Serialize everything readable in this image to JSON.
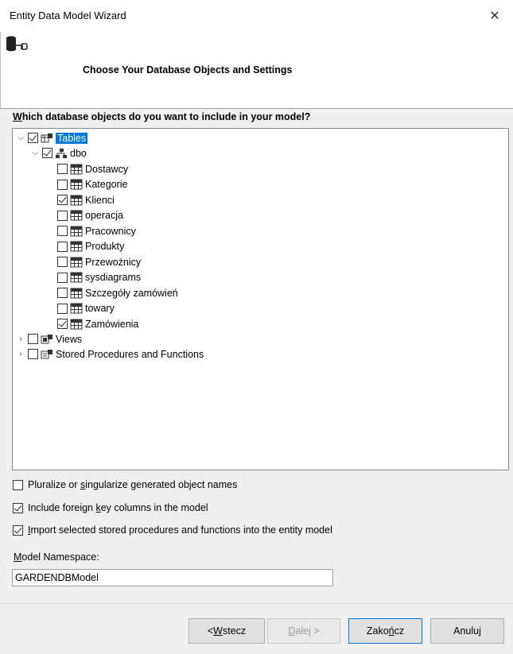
{
  "window": {
    "title": "Entity Data Model Wizard"
  },
  "header": {
    "heading": "Choose Your Database Objects and Settings"
  },
  "question": {
    "ul": "W",
    "rest": "hich database objects do you want to include in your model?"
  },
  "tree": {
    "tables_label": "Tables",
    "schema_label": "dbo",
    "tables": [
      {
        "name": "Dostawcy",
        "checked": false
      },
      {
        "name": "Kategorie",
        "checked": false
      },
      {
        "name": "Klienci",
        "checked": true
      },
      {
        "name": "operacja",
        "checked": false
      },
      {
        "name": "Pracownicy",
        "checked": false
      },
      {
        "name": "Produkty",
        "checked": false
      },
      {
        "name": "Przewoźnicy",
        "checked": false
      },
      {
        "name": "sysdiagrams",
        "checked": false
      },
      {
        "name": "Szczegóły zamówień",
        "checked": false
      },
      {
        "name": "towary",
        "checked": false
      },
      {
        "name": "Zamówienia",
        "checked": true
      }
    ],
    "views_label": "Views",
    "procs_label": "Stored Procedures and Functions"
  },
  "options": {
    "pluralize": {
      "pre": "Pluralize or ",
      "ul": "s",
      "post": "ingularize generated object names",
      "checked": false
    },
    "foreign_keys": {
      "pre": "Include foreign ",
      "ul": "k",
      "post": "ey columns in the model",
      "checked": true
    },
    "import_procs": {
      "pre": "",
      "ul": "I",
      "post": "mport selected stored procedures and functions into the entity model",
      "checked": true
    }
  },
  "namespace": {
    "label_ul": "M",
    "label_rest": "odel Namespace:",
    "value": "GARDENDBModel"
  },
  "buttons": {
    "back_pre": "< ",
    "back_ul": "W",
    "back_post": "stecz",
    "next_ul": "D",
    "next_post": "alej >",
    "finish_pre": "Zako",
    "finish_ul": "ń",
    "finish_post": "cz",
    "cancel": "Anuluj"
  }
}
